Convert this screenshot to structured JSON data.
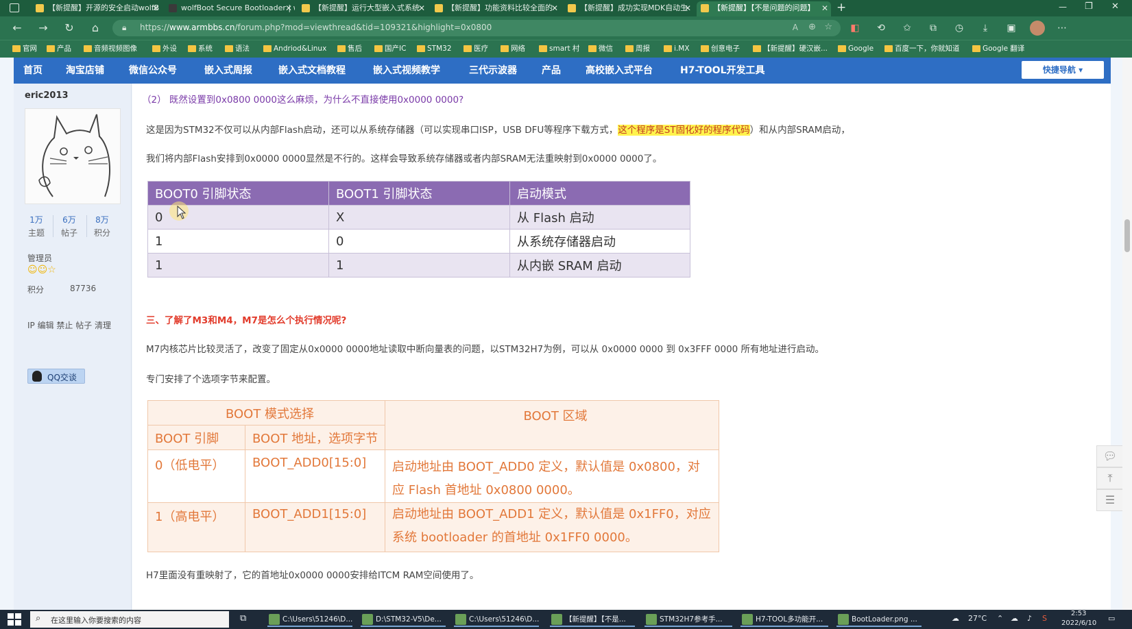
{
  "browser": {
    "tabs": [
      {
        "label": "【新提醒】开源的安全启动wolfB",
        "active": false
      },
      {
        "label": "wolfBoot Secure Bootloader | wo",
        "active": false
      },
      {
        "label": "【新提醒】运行大型嵌入式系统",
        "active": false
      },
      {
        "label": "【新提醒】功能资料比较全面的",
        "active": false
      },
      {
        "label": "【新提醒】成功实现MDK自动生",
        "active": false
      },
      {
        "label": "【新提醒】【不是问题的问题】",
        "active": true
      }
    ],
    "new_tab": "+",
    "url_prefix": "https://",
    "url_domain": "www.armbbs.cn",
    "url_path": "/forum.php?mod=viewthread&tid=109321&highlight=0x0800",
    "bookmarks": [
      "官网",
      "产品",
      "音频视频图像",
      "外设",
      "系统",
      "语法",
      "Andriod&Linux",
      "售后",
      "国产IC",
      "STM32",
      "医疗",
      "网络",
      "smart 村",
      "微信",
      "周报",
      "i.MX",
      "创意电子",
      "【新提醒】硬汉嵌...",
      "Google",
      "百度一下，你就知道",
      "Google 翻译"
    ]
  },
  "forum": {
    "nav": [
      "首页",
      "淘宝店铺",
      "微信公众号",
      "嵌入式周报",
      "嵌入式文档教程",
      "嵌入式视频教学",
      "三代示波器",
      "产品",
      "高校嵌入式平台",
      "H7-TOOL开发工具"
    ],
    "quick_nav": "快捷导航 ▾",
    "user": {
      "name": "eric2013",
      "stats": [
        {
          "value": "1万",
          "label": "主题"
        },
        {
          "value": "6万",
          "label": "帖子"
        },
        {
          "value": "8万",
          "label": "积分"
        }
      ],
      "role": "管理员",
      "points_label": "积分",
      "points_value": "87736",
      "qq_button": "QQ交谈",
      "admin_links": "IP 编辑 禁止 帖子 清理"
    }
  },
  "post": {
    "q2": "（2） 既然设置到0x0800 0000这么麻烦，为什么不直接使用0x0000 0000?",
    "p1_a": "这是因为STM32不仅可以从内部Flash启动，还可以从系统存储器（可以实现串口ISP，USB DFU等程序下载方式，",
    "p1_highlight": "这个程序是ST固化好的程序代码",
    "p1_b": "）和从内部SRAM启动，",
    "p2": "我们将内部Flash安排到0x0000 0000显然是不行的。这样会导致系统存储器或者内部SRAM无法重映射到0x0000 0000了。",
    "table1": {
      "headers": [
        "BOOT0 引脚状态",
        "BOOT1 引脚状态",
        "启动模式"
      ],
      "rows": [
        [
          "0",
          "X",
          "从 Flash 启动"
        ],
        [
          "1",
          "0",
          "从系统存储器启动"
        ],
        [
          "1",
          "1",
          "从内嵌 SRAM 启动"
        ]
      ]
    },
    "section3": "三、了解了M3和M4，M7是怎么个执行情况呢?",
    "p3": "M7内核芯片比较灵活了，改变了固定从0x0000 0000地址读取中断向量表的问题，以STM32H7为例，可以从 0x0000 0000 到 0x3FFF 0000 所有地址进行启动。",
    "p4": "专门安排了个选项字节来配置。",
    "table2": {
      "h_mode": "BOOT 模式选择",
      "h_area": "BOOT 区域",
      "h_pin": "BOOT 引脚",
      "h_addr": "BOOT 地址，选项字节",
      "rows": [
        {
          "pin": "0（低电平）",
          "addr": "BOOT_ADD0[15:0]",
          "area": "启动地址由 BOOT_ADD0 定义，默认值是 0x0800，对应 Flash 首地址 0x0800 0000。"
        },
        {
          "pin": "1（高电平）",
          "addr": "BOOT_ADD1[15:0]",
          "area": "启动地址由 BOOT_ADD1 定义，默认值是 0x1FF0，对应系统 bootloader 的首地址 0x1FF0 0000。"
        }
      ]
    },
    "p5": "H7里面没有重映射了，它的首地址0x0000 0000安排给ITCM RAM空间使用了。"
  },
  "taskbar": {
    "search_placeholder": "在这里输入你要搜索的内容",
    "apps": [
      "C:\\Users\\51246\\D...",
      "D:\\STM32-V5\\De...",
      "C:\\Users\\51246\\D...",
      "【新提醒】【不是...",
      "STM32H7参考手...",
      "H7-TOOL多功能开...",
      "BootLoader.png ..."
    ],
    "weather": "27°C",
    "time": "2:53",
    "date": "2022/6/10"
  }
}
